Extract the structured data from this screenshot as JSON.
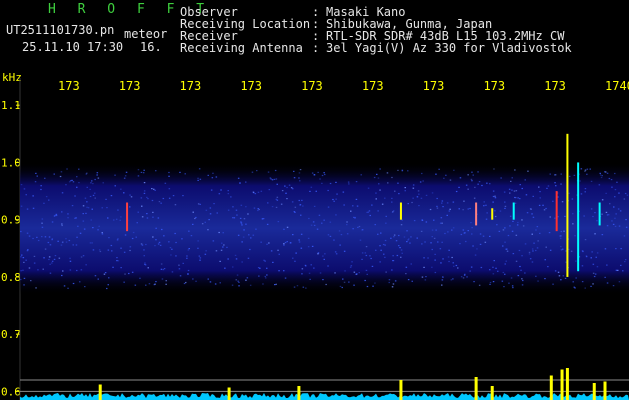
{
  "header": {
    "title": "H R O F F T",
    "filename": "UT2511101730.pn",
    "file_suffix": "meteor",
    "datetime": "25.11.10 17:30",
    "datetime_suffix": "16.",
    "info": [
      {
        "label": "Observer",
        "value": "Masaki Kano"
      },
      {
        "label": "Receiving Location",
        "value": "Shibukawa, Gunma, Japan"
      },
      {
        "label": "Receiver",
        "value": "RTL-SDR SDR# 43dB L15 103.2MHz CW"
      },
      {
        "label": "Receiving Antenna",
        "value": "3el Yagi(V) Az 330 for Vladivostok"
      }
    ],
    "colon": ":"
  },
  "colors": {
    "background": "#000000",
    "axis_text": "#ffff00",
    "header_text": "#e6e6e6",
    "title": "#3ecf3e",
    "noise_low": "#0c0c6e",
    "noise_high": "#3a5cff",
    "power_trace": "#00c8ff",
    "echo_trace": "#ffff00",
    "gridline": "#8c8c8c"
  },
  "chart_data": {
    "type": "heatmap",
    "title": "",
    "xlabel": "",
    "ylabel": "kHz",
    "x_tick_labels": [
      "173",
      "173",
      "173",
      "173",
      "173",
      "173",
      "173",
      "173",
      "173",
      "1740"
    ],
    "y_ticks": [
      1.1,
      1.0,
      0.9,
      0.8,
      0.7,
      0.6
    ],
    "y_tick_labels": [
      "1.1",
      "1.0",
      "0.9",
      "0.8",
      "0.7",
      "0.6"
    ],
    "xlim": [
      1730,
      1740
    ],
    "ylim": [
      0.585,
      1.165
    ],
    "noise_band_khz": [
      0.78,
      0.99
    ],
    "echoes": [
      {
        "time": 1731.1,
        "khz_low": 0.88,
        "khz_high": 0.93,
        "color": "#ff4040"
      },
      {
        "time": 1736.2,
        "khz_low": 0.9,
        "khz_high": 0.93,
        "color": "#ffff00"
      },
      {
        "time": 1737.6,
        "khz_low": 0.89,
        "khz_high": 0.93,
        "color": "#ff8080"
      },
      {
        "time": 1737.9,
        "khz_low": 0.9,
        "khz_high": 0.92,
        "color": "#ffff00"
      },
      {
        "time": 1738.3,
        "khz_low": 0.9,
        "khz_high": 0.93,
        "color": "#00ffff"
      },
      {
        "time": 1739.1,
        "khz_low": 0.88,
        "khz_high": 0.95,
        "color": "#ff3030"
      },
      {
        "time": 1739.3,
        "khz_low": 0.8,
        "khz_high": 1.05,
        "color": "#ffff00"
      },
      {
        "time": 1739.5,
        "khz_low": 0.81,
        "khz_high": 1.0,
        "color": "#00ffff"
      },
      {
        "time": 1739.9,
        "khz_low": 0.89,
        "khz_high": 0.93,
        "color": "#00ffff"
      }
    ],
    "power_spikes": [
      {
        "time": 1730.6,
        "level": 0.45
      },
      {
        "time": 1733.0,
        "level": 0.35
      },
      {
        "time": 1734.3,
        "level": 0.4
      },
      {
        "time": 1736.2,
        "level": 0.6
      },
      {
        "time": 1737.6,
        "level": 0.7
      },
      {
        "time": 1737.9,
        "level": 0.4
      },
      {
        "time": 1739.0,
        "level": 0.75
      },
      {
        "time": 1739.2,
        "level": 0.95
      },
      {
        "time": 1739.3,
        "level": 1.0
      },
      {
        "time": 1739.8,
        "level": 0.5
      },
      {
        "time": 1740.0,
        "level": 0.55
      }
    ],
    "grid": false
  }
}
